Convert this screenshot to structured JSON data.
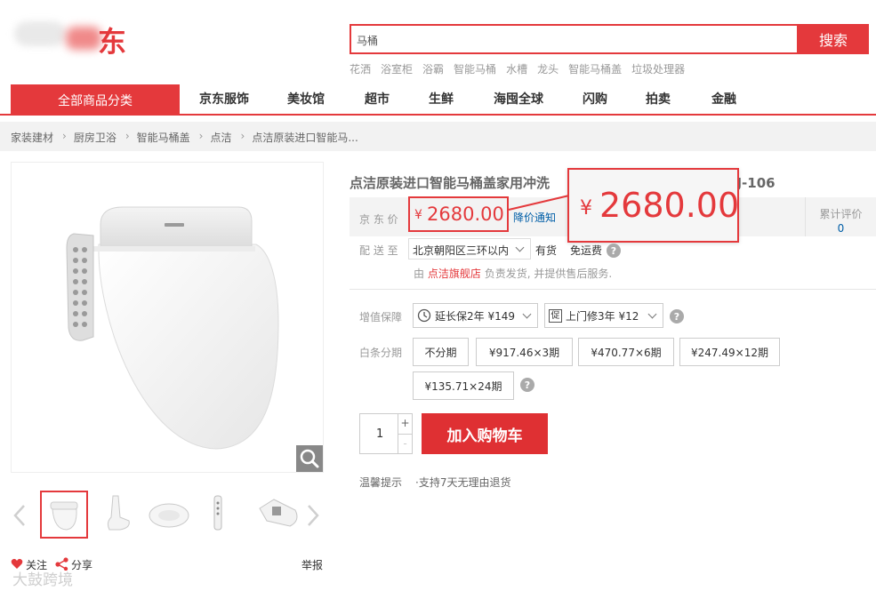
{
  "header": {
    "logo_text": "东",
    "search_placeholder": "马桶",
    "search_button": "搜索",
    "hot_words": [
      "花洒",
      "浴室柜",
      "浴霸",
      "智能马桶",
      "水槽",
      "龙头",
      "智能马桶盖",
      "垃圾处理器"
    ]
  },
  "nav": {
    "all_categories": "全部商品分类",
    "items": [
      "京东服饰",
      "美妆馆",
      "超市",
      "生鲜",
      "海囤全球",
      "闪购",
      "拍卖",
      "金融"
    ]
  },
  "breadcrumb": [
    "家装建材",
    "厨房卫浴",
    "智能马桶盖",
    "点洁",
    "点洁原装进口智能马..."
  ],
  "gallery": {
    "actions": {
      "follow": "关注",
      "share": "分享",
      "report": "举报"
    }
  },
  "product": {
    "title_start": "点洁原装进口智能马桶盖家用冲洗",
    "title_end": "盖DJ-106",
    "price_label": "京 东 价",
    "currency": "¥",
    "price": "2680.00",
    "price_notify": "降价通知",
    "review_label": "累计评价",
    "review_count": "0",
    "delivery_label": "配 送 至",
    "region": "北京朝阳区三环以内",
    "stock": "有货",
    "shipping": "免运费",
    "seller_prefix": "由",
    "seller_name": "点洁旗舰店",
    "seller_suffix": "负责发货, 并提供售后服务."
  },
  "service": {
    "label": "增值保障",
    "extended_warranty": "延长保2年 ¥149",
    "home_repair": "上门修3年 ¥12"
  },
  "installment": {
    "label": "白条分期",
    "options": [
      "不分期",
      "¥917.46×3期",
      "¥470.77×6期",
      "¥247.49×12期",
      "¥135.71×24期"
    ]
  },
  "purchase": {
    "quantity": "1",
    "plus": "+",
    "minus": "-",
    "add_to_cart": "加入购物车",
    "tips_label": "温馨提示",
    "tips_text": "·支持7天无理由退货"
  },
  "watermark": "大鼓跨境",
  "colors": {
    "brand_red": "#e4393c",
    "link_blue": "#005ea7"
  }
}
